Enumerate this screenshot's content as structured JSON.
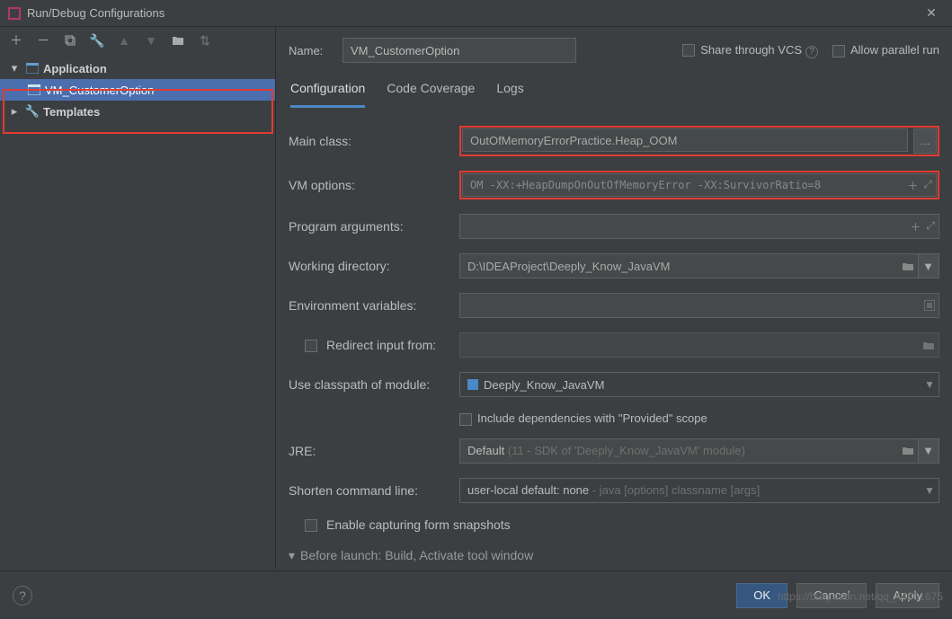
{
  "window": {
    "title": "Run/Debug Configurations"
  },
  "sidebar": {
    "application_label": "Application",
    "config_item": "VM_CustomerOption",
    "templates_label": "Templates"
  },
  "header": {
    "name_label": "Name:",
    "name_value": "VM_CustomerOption",
    "share_vcs": "Share through VCS",
    "allow_parallel": "Allow parallel run"
  },
  "tabs": {
    "configuration": "Configuration",
    "coverage": "Code Coverage",
    "logs": "Logs"
  },
  "form": {
    "main_class_label": "Main class:",
    "main_class_value": "OutOfMemoryErrorPractice.Heap_OOM",
    "vm_options_label": "VM options:",
    "vm_options_value": "OM -XX:+HeapDumpOnOutOfMemoryError -XX:SurvivorRatio=8",
    "program_args_label": "Program arguments:",
    "workdir_label": "Working directory:",
    "workdir_value": "D:\\IDEAProject\\Deeply_Know_JavaVM",
    "env_label": "Environment variables:",
    "redirect_label": "Redirect input from:",
    "classpath_label": "Use classpath of module:",
    "classpath_value": "Deeply_Know_JavaVM",
    "include_provided": "Include dependencies with \"Provided\" scope",
    "jre_label": "JRE:",
    "jre_prefix": "Default",
    "jre_hint": "(11 - SDK of 'Deeply_Know_JavaVM' module)",
    "shorten_label": "Shorten command line:",
    "shorten_prefix": "user-local default: none",
    "shorten_hint": "- java [options] classname [args]",
    "enable_snapshots": "Enable capturing form snapshots",
    "before_launch": "Before launch: Build, Activate tool window"
  },
  "footer": {
    "ok": "OK",
    "cancel": "Cancel",
    "apply": "Apply"
  },
  "watermark": "https://blog.csdn.net/qq_44861675"
}
